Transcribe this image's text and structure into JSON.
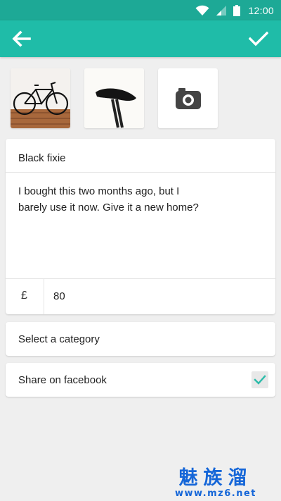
{
  "status_bar": {
    "time": "12:00"
  },
  "header": {
    "back_icon": "arrow-left-icon",
    "confirm_icon": "checkmark-icon"
  },
  "photos": [
    {
      "name": "bicycle-photo"
    },
    {
      "name": "saddle-photo"
    },
    {
      "name": "add-photo",
      "icon": "camera-icon"
    }
  ],
  "listing": {
    "title": "Black fixie",
    "description_line1": "I bought this two months ago, but I",
    "description_line2": "barely use it now. Give it a new home?",
    "currency": "£",
    "price": "80"
  },
  "category": {
    "label": "Select a category"
  },
  "facebook": {
    "label": "Share on facebook",
    "checked": true
  },
  "watermark": {
    "chinese": "魅族溜",
    "url": "www.mz6.net"
  },
  "colors": {
    "status_bar": "#1da996",
    "app_bar": "#1fbca8",
    "check": "#2cbcaa",
    "background": "#efefef"
  }
}
